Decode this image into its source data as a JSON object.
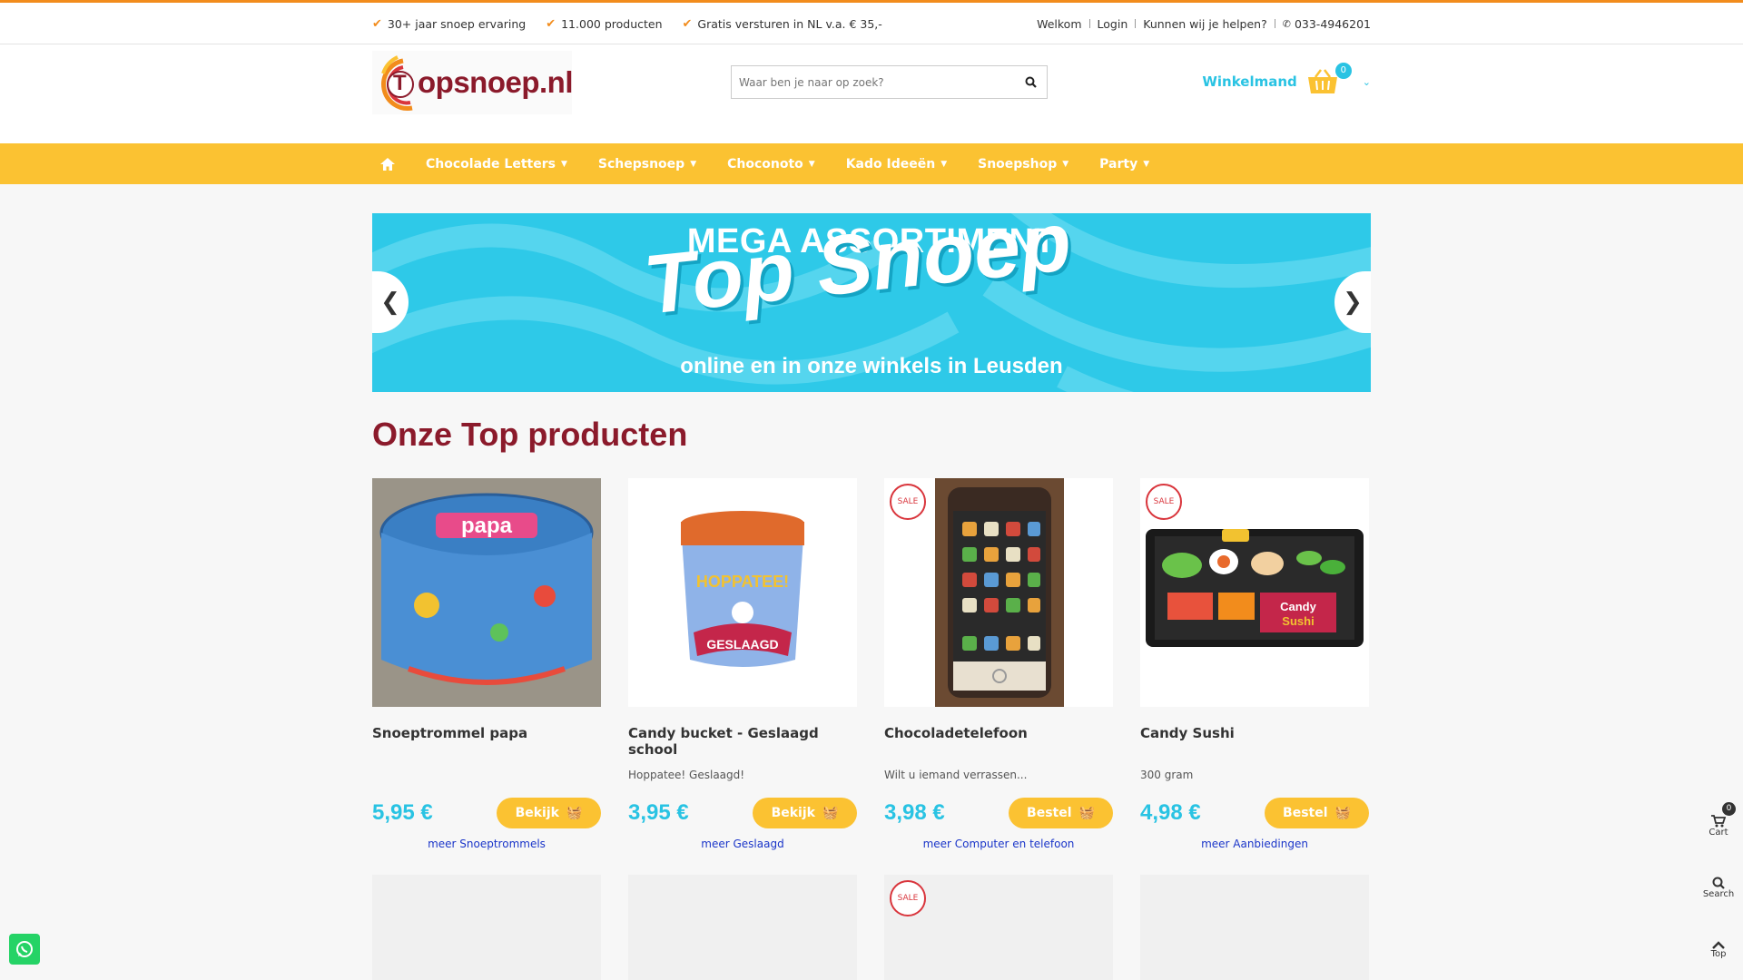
{
  "usps": [
    {
      "label": "30+ jaar snoep ervaring"
    },
    {
      "label": "11.000 producten"
    },
    {
      "label": "Gratis versturen in NL v.a. € 35,-"
    }
  ],
  "toplinks": {
    "welcome": "Welkom",
    "login": "Login",
    "help": "Kunnen wij je helpen?",
    "phone": "033-4946201"
  },
  "logo": {
    "text": "opsnoep.nl",
    "mark": "T"
  },
  "search": {
    "placeholder": "Waar ben je naar op zoek?"
  },
  "cart": {
    "label": "Winkelmand",
    "count": "0"
  },
  "nav": {
    "items": [
      {
        "label": "Chocolade Letters"
      },
      {
        "label": "Schepsnoep"
      },
      {
        "label": "Choconoto"
      },
      {
        "label": "Kado Ideeën"
      },
      {
        "label": "Snoepshop"
      },
      {
        "label": "Party"
      }
    ]
  },
  "banner": {
    "line1": "MEGA ASSORTIMENT",
    "line2": "Top Snoep",
    "line3": "online en in onze winkels in Leusden"
  },
  "section_title": "Onze Top producten",
  "products": [
    {
      "title": "Snoeptrommel papa",
      "subtitle": "",
      "price": "5,95 €",
      "button": "Bekijk",
      "more": "meer Snoeptrommels",
      "sale": false
    },
    {
      "title": "Candy bucket - Geslaagd school",
      "subtitle": "Hoppatee! Geslaagd!",
      "price": "3,95 €",
      "button": "Bekijk",
      "more": "meer Geslaagd",
      "sale": false
    },
    {
      "title": "Chocoladetelefoon",
      "subtitle": "Wilt u iemand verrassen...",
      "price": "3,98 €",
      "button": "Bestel",
      "more": "meer Computer en telefoon",
      "sale": true
    },
    {
      "title": "Candy Sushi",
      "subtitle": "300 gram",
      "price": "4,98 €",
      "button": "Bestel",
      "more": "meer Aanbiedingen",
      "sale": true
    }
  ],
  "sale_label": "SALE",
  "side": {
    "cart_label": "Cart",
    "cart_count": "0",
    "search_label": "Search",
    "top_label": "Top"
  },
  "colors": {
    "accent_orange": "#f28c1c",
    "nav_yellow": "#fbc232",
    "brand_red": "#8b1a2b",
    "price_cyan": "#29c3e3",
    "banner_blue": "#2ec9e8"
  }
}
